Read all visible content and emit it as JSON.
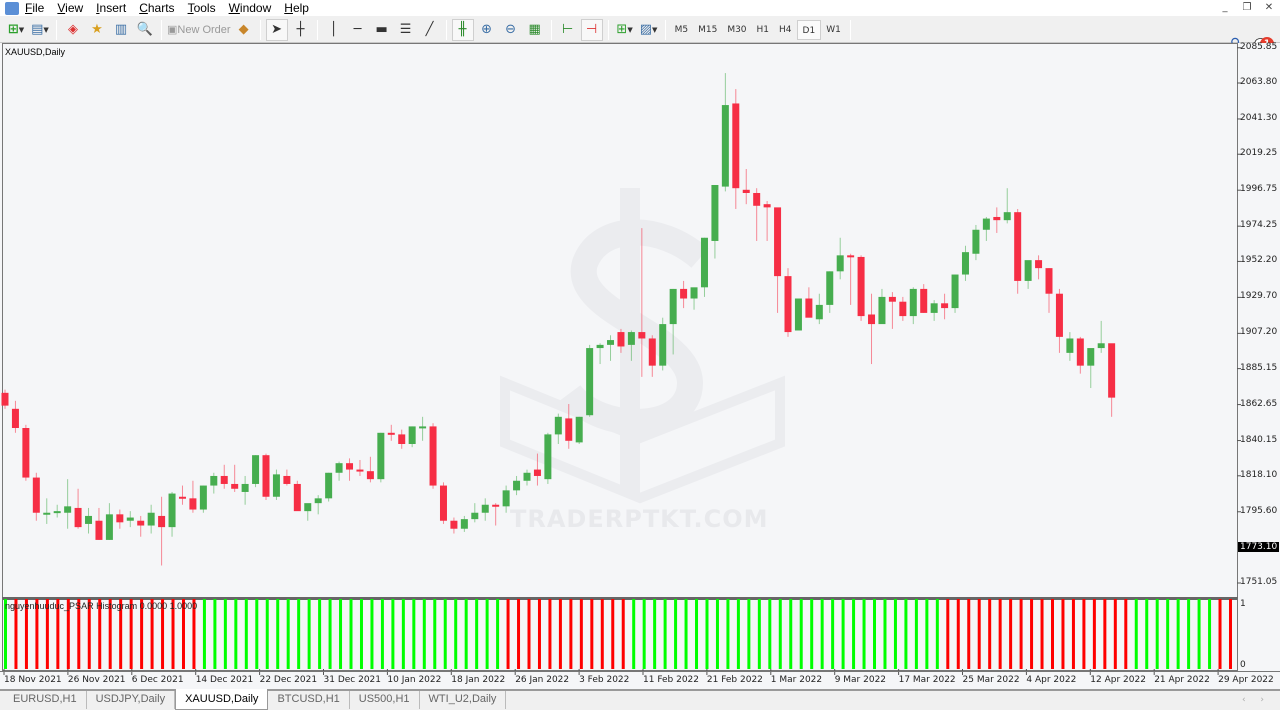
{
  "menu": {
    "items": [
      "File",
      "View",
      "Insert",
      "Charts",
      "Tools",
      "Window",
      "Help"
    ]
  },
  "window_controls": [
    "minimize",
    "restore",
    "close"
  ],
  "toolbar": {
    "new_order_label": "New Order",
    "timeframes": [
      "M5",
      "M15",
      "M30",
      "H1",
      "H4",
      "D1",
      "W1"
    ],
    "active_timeframe": "D1",
    "notification_count": "1"
  },
  "chart": {
    "title": "XAUUSD,Daily",
    "indicator_title": "nguyenhuuduc_PSAR Histogram 0.0000 1.0000",
    "watermark": "TRADERPTKT.COM",
    "current_price": "1773.10",
    "colors": {
      "bull": "#46ad4f",
      "bear": "#f62e45",
      "hist_bull": "#00ff00",
      "hist_bear": "#ff0000",
      "bg": "#f5f6f8"
    }
  },
  "chart_data": {
    "type": "candlestick",
    "symbol": "XAUUSD",
    "timeframe": "Daily",
    "y_ticks": [
      "2085.85",
      "2063.80",
      "2041.30",
      "2019.25",
      "1996.75",
      "1974.25",
      "1952.20",
      "1929.70",
      "1907.20",
      "1885.15",
      "1862.65",
      "1840.15",
      "1818.10",
      "1795.60",
      "1751.05"
    ],
    "ylim": [
      1737,
      2090
    ],
    "x_ticks": [
      "18 Nov 2021",
      "26 Nov 2021",
      "6 Dec 2021",
      "14 Dec 2021",
      "22 Dec 2021",
      "31 Dec 2021",
      "10 Jan 2022",
      "18 Jan 2022",
      "26 Jan 2022",
      "3 Feb 2022",
      "11 Feb 2022",
      "21 Feb 2022",
      "1 Mar 2022",
      "9 Mar 2022",
      "17 Mar 2022",
      "25 Mar 2022",
      "4 Apr 2022",
      "12 Apr 2022",
      "21 Apr 2022",
      "29 Apr 2022"
    ],
    "indicator": {
      "name": "nguyenhuuduc_PSAR Histogram",
      "levels": [
        "1",
        "0"
      ],
      "ylim": [
        0,
        1
      ]
    },
    "candles": [
      [
        1870,
        1872,
        1860,
        1862
      ],
      [
        1860,
        1865,
        1845,
        1848
      ],
      [
        1848,
        1850,
        1815,
        1817
      ],
      [
        1817,
        1820,
        1790,
        1795
      ],
      [
        1795,
        1804,
        1788,
        1795
      ],
      [
        1795,
        1800,
        1792,
        1796
      ],
      [
        1795,
        1816,
        1785,
        1799
      ],
      [
        1798,
        1810,
        1785,
        1786
      ],
      [
        1788,
        1798,
        1782,
        1793
      ],
      [
        1790,
        1798,
        1778,
        1778
      ],
      [
        1778,
        1801,
        1778,
        1794
      ],
      [
        1794,
        1797,
        1785,
        1789
      ],
      [
        1790,
        1796,
        1786,
        1792
      ],
      [
        1790,
        1793,
        1780,
        1787
      ],
      [
        1787,
        1800,
        1782,
        1795
      ],
      [
        1793,
        1805,
        1762,
        1786
      ],
      [
        1786,
        1808,
        1780,
        1807
      ],
      [
        1805,
        1812,
        1800,
        1804
      ],
      [
        1804,
        1815,
        1795,
        1797
      ],
      [
        1797,
        1812,
        1795,
        1812
      ],
      [
        1812,
        1820,
        1807,
        1818
      ],
      [
        1818,
        1825,
        1810,
        1813
      ],
      [
        1813,
        1825,
        1808,
        1810
      ],
      [
        1808,
        1818,
        1800,
        1813
      ],
      [
        1813,
        1831,
        1811,
        1831
      ],
      [
        1831,
        1832,
        1803,
        1805
      ],
      [
        1805,
        1822,
        1803,
        1819
      ],
      [
        1818,
        1822,
        1812,
        1813
      ],
      [
        1813,
        1815,
        1798,
        1796
      ],
      [
        1796,
        1800,
        1790,
        1801
      ],
      [
        1801,
        1806,
        1794,
        1804
      ],
      [
        1804,
        1820,
        1802,
        1820
      ],
      [
        1820,
        1827,
        1815,
        1826
      ],
      [
        1826,
        1829,
        1815,
        1822
      ],
      [
        1822,
        1828,
        1818,
        1821
      ],
      [
        1821,
        1830,
        1814,
        1816
      ],
      [
        1816,
        1845,
        1814,
        1845
      ],
      [
        1845,
        1850,
        1840,
        1844
      ],
      [
        1844,
        1847,
        1835,
        1838
      ],
      [
        1838,
        1849,
        1836,
        1849
      ],
      [
        1849,
        1855,
        1840,
        1849
      ],
      [
        1849,
        1851,
        1810,
        1812
      ],
      [
        1812,
        1814,
        1788,
        1790
      ],
      [
        1790,
        1792,
        1782,
        1785
      ],
      [
        1785,
        1793,
        1783,
        1791
      ],
      [
        1791,
        1801,
        1789,
        1795
      ],
      [
        1795,
        1804,
        1790,
        1800
      ],
      [
        1800,
        1801,
        1787,
        1799
      ],
      [
        1799,
        1812,
        1795,
        1809
      ],
      [
        1809,
        1818,
        1806,
        1815
      ],
      [
        1815,
        1822,
        1812,
        1820
      ],
      [
        1822,
        1832,
        1812,
        1818
      ],
      [
        1816,
        1845,
        1813,
        1844
      ],
      [
        1844,
        1857,
        1838,
        1855
      ],
      [
        1854,
        1863,
        1835,
        1840
      ],
      [
        1839,
        1855,
        1838,
        1855
      ],
      [
        1856,
        1900,
        1855,
        1898
      ],
      [
        1898,
        1901,
        1888,
        1900
      ],
      [
        1900,
        1906,
        1890,
        1903
      ],
      [
        1908,
        1910,
        1895,
        1899
      ],
      [
        1900,
        1909,
        1890,
        1908
      ],
      [
        1908,
        1973,
        1880,
        1904
      ],
      [
        1904,
        1906,
        1880,
        1887
      ],
      [
        1887,
        1917,
        1884,
        1913
      ],
      [
        1913,
        1935,
        1894,
        1935
      ],
      [
        1935,
        1940,
        1923,
        1929
      ],
      [
        1929,
        1935,
        1922,
        1936
      ],
      [
        1936,
        1967,
        1930,
        1967
      ],
      [
        1965,
        1993,
        1954,
        2000
      ],
      [
        1999,
        2070,
        1996,
        2050
      ],
      [
        2051,
        2060,
        1985,
        1998
      ],
      [
        1997,
        2010,
        1988,
        1995
      ],
      [
        1995,
        1998,
        1965,
        1987
      ],
      [
        1988,
        1990,
        1965,
        1986
      ],
      [
        1986,
        1964,
        1920,
        1943
      ],
      [
        1943,
        1948,
        1905,
        1908
      ],
      [
        1909,
        1922,
        1915,
        1929
      ],
      [
        1929,
        1936,
        1918,
        1917
      ],
      [
        1916,
        1932,
        1913,
        1925
      ],
      [
        1925,
        1946,
        1920,
        1946
      ],
      [
        1946,
        1967,
        1941,
        1956
      ],
      [
        1956,
        1957,
        1925,
        1955
      ],
      [
        1955,
        1956,
        1915,
        1918
      ],
      [
        1919,
        1932,
        1888,
        1913
      ],
      [
        1913,
        1935,
        1914,
        1930
      ],
      [
        1930,
        1933,
        1910,
        1927
      ],
      [
        1927,
        1930,
        1915,
        1918
      ],
      [
        1918,
        1936,
        1913,
        1935
      ],
      [
        1935,
        1938,
        1920,
        1920
      ],
      [
        1920,
        1928,
        1915,
        1926
      ],
      [
        1926,
        1932,
        1916,
        1923
      ],
      [
        1923,
        1944,
        1920,
        1944
      ],
      [
        1944,
        1962,
        1940,
        1958
      ],
      [
        1957,
        1975,
        1953,
        1972
      ],
      [
        1972,
        1980,
        1965,
        1979
      ],
      [
        1980,
        1986,
        1970,
        1978
      ],
      [
        1978,
        1998,
        1976,
        1983
      ],
      [
        1983,
        1985,
        1932,
        1940
      ],
      [
        1940,
        1944,
        1935,
        1953
      ],
      [
        1953,
        1956,
        1941,
        1948
      ],
      [
        1948,
        1948,
        1920,
        1932
      ],
      [
        1932,
        1935,
        1895,
        1905
      ],
      [
        1895,
        1908,
        1890,
        1904
      ],
      [
        1904,
        1905,
        1882,
        1887
      ],
      [
        1887,
        1896,
        1873,
        1898
      ],
      [
        1898,
        1915,
        1895,
        1901
      ],
      [
        1901,
        1898,
        1855,
        1867
      ]
    ],
    "psar_histogram": [
      "bull",
      "bear",
      "bear",
      "bear",
      "bear",
      "bear",
      "bear",
      "bear",
      "bear",
      "bear",
      "bear",
      "bear",
      "bear",
      "bear",
      "bear",
      "bear",
      "bear",
      "bear",
      "bear",
      "bull",
      "bull",
      "bull",
      "bull",
      "bull",
      "bull",
      "bull",
      "bull",
      "bull",
      "bull",
      "bull",
      "bull",
      "bull",
      "bull",
      "bull",
      "bull",
      "bull",
      "bull",
      "bull",
      "bull",
      "bull",
      "bull",
      "bull",
      "bull",
      "bull",
      "bull",
      "bull",
      "bull",
      "bull",
      "bear",
      "bear",
      "bear",
      "bear",
      "bear",
      "bear",
      "bear",
      "bear",
      "bear",
      "bear",
      "bear",
      "bear",
      "bull",
      "bull",
      "bull",
      "bull",
      "bull",
      "bull",
      "bull",
      "bull",
      "bull",
      "bull",
      "bull",
      "bull",
      "bull",
      "bull",
      "bull",
      "bull",
      "bull",
      "bull",
      "bull",
      "bull",
      "bull",
      "bull",
      "bull",
      "bull",
      "bull",
      "bull",
      "bull",
      "bull",
      "bull",
      "bull",
      "bear",
      "bear",
      "bear",
      "bear",
      "bear",
      "bear",
      "bear",
      "bear",
      "bear",
      "bear",
      "bear",
      "bear",
      "bear",
      "bear",
      "bear",
      "bear",
      "bear",
      "bear",
      "bull",
      "bull",
      "bull",
      "bull",
      "bull",
      "bull",
      "bull",
      "bull",
      "bear",
      "bear",
      "bear",
      "bear",
      "bear",
      "bear"
    ]
  },
  "tabs": {
    "items": [
      "EURUSD,H1",
      "USDJPY,Daily",
      "XAUUSD,Daily",
      "BTCUSD,H1",
      "US500,H1",
      "WTI_U2,Daily"
    ],
    "active": "XAUUSD,Daily"
  }
}
